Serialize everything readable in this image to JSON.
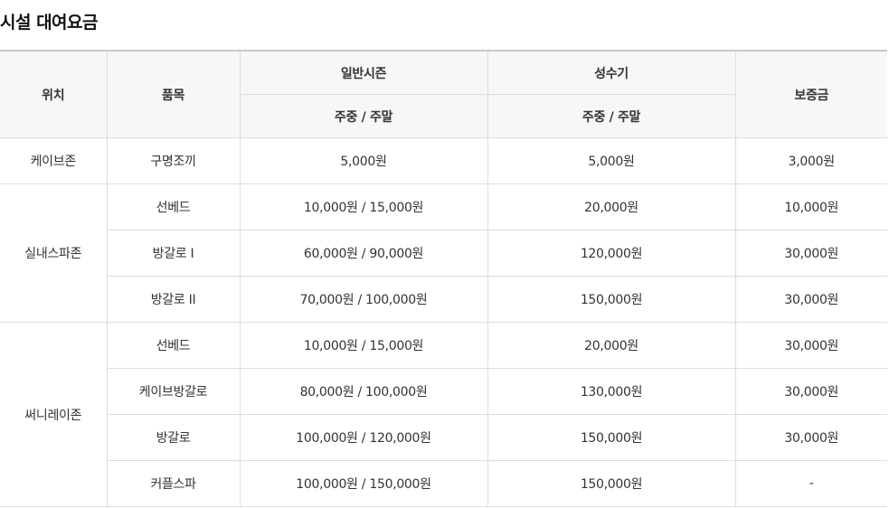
{
  "title": "시설 대여요금",
  "header": {
    "location": "위치",
    "item": "품목",
    "normal_season": "일반시즌",
    "peak_season": "성수기",
    "deposit": "보증금",
    "normal_sub": "주중 / 주말",
    "peak_sub": "주중 / 주말"
  },
  "groups": [
    {
      "location": "케이브존",
      "rows": [
        {
          "item": "구명조끼",
          "normal": "5,000원",
          "peak": "5,000원",
          "deposit": "3,000원"
        }
      ]
    },
    {
      "location": "실내스파존",
      "rows": [
        {
          "item": "선베드",
          "normal": "10,000원 / 15,000원",
          "peak": "20,000원",
          "deposit": "10,000원"
        },
        {
          "item": "방갈로 I",
          "normal": "60,000원 / 90,000원",
          "peak": "120,000원",
          "deposit": "30,000원"
        },
        {
          "item": "방갈로 II",
          "normal": "70,000원 / 100,000원",
          "peak": "150,000원",
          "deposit": "30,000원"
        }
      ]
    },
    {
      "location": "써니레이존",
      "rows": [
        {
          "item": "선베드",
          "normal": "10,000원 / 15,000원",
          "peak": "20,000원",
          "deposit": "30,000원"
        },
        {
          "item": "케이브방갈로",
          "normal": "80,000원 / 100,000원",
          "peak": "130,000원",
          "deposit": "30,000원"
        },
        {
          "item": "방갈로",
          "normal": "100,000원 / 120,000원",
          "peak": "150,000원",
          "deposit": "30,000원"
        },
        {
          "item": "커플스파",
          "normal": "100,000원 / 150,000원",
          "peak": "150,000원",
          "deposit": "-"
        }
      ]
    }
  ]
}
